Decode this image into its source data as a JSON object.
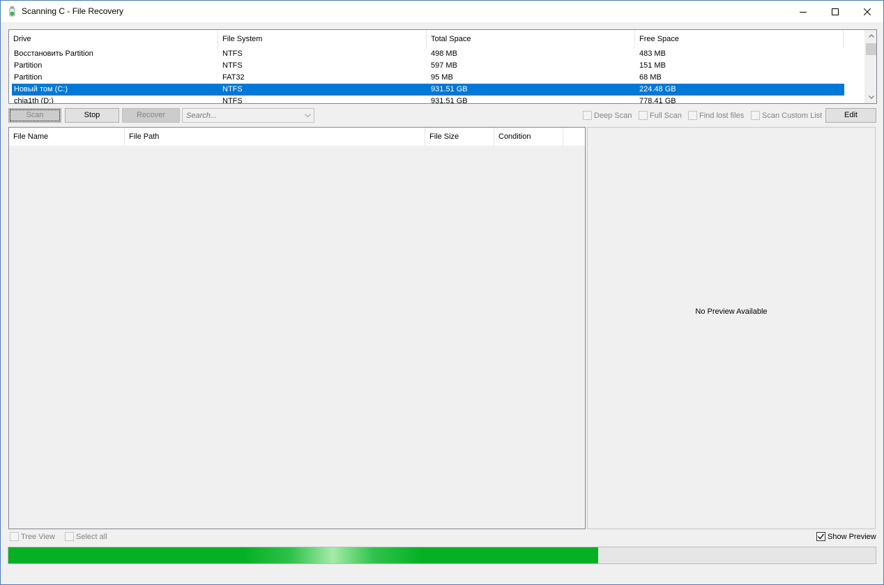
{
  "window": {
    "title": "Scanning C - File Recovery"
  },
  "drives": {
    "columns": [
      "Drive",
      "File System",
      "Total Space",
      "Free Space"
    ],
    "rows": [
      {
        "drive": "Восстановить Partition",
        "fs": "NTFS",
        "total": "498 MB",
        "free": "483 MB",
        "selected": false
      },
      {
        "drive": " Partition",
        "fs": "NTFS",
        "total": "597 MB",
        "free": "151 MB",
        "selected": false
      },
      {
        "drive": " Partition",
        "fs": "FAT32",
        "total": "95 MB",
        "free": "68 MB",
        "selected": false
      },
      {
        "drive": "Новый том (C:)",
        "fs": "NTFS",
        "total": "931.51 GB",
        "free": "224.48 GB",
        "selected": true
      },
      {
        "drive": "chia1th (D:)",
        "fs": "NTFS",
        "total": "931.51 GB",
        "free": "778.41 GB",
        "selected": false
      }
    ]
  },
  "toolbar": {
    "scan_label": "Scan",
    "stop_label": "Stop",
    "recover_label": "Recover",
    "search_placeholder": "Search...",
    "edit_label": "Edit"
  },
  "options": {
    "deep_scan": "Deep Scan",
    "full_scan": "Full Scan",
    "find_lost": "Find lost files",
    "scan_custom": "Scan Custom List"
  },
  "files": {
    "columns": [
      "File Name",
      "File Path",
      "File Size",
      "Condition"
    ]
  },
  "preview": {
    "empty_text": "No Preview Available"
  },
  "bottom": {
    "tree_view": "Tree View",
    "select_all": "Select all",
    "show_preview": "Show Preview",
    "show_preview_checked": true
  },
  "progress": {
    "value": 0.68
  },
  "colors": {
    "selection": "#0078d7",
    "progress": "#06b025"
  }
}
